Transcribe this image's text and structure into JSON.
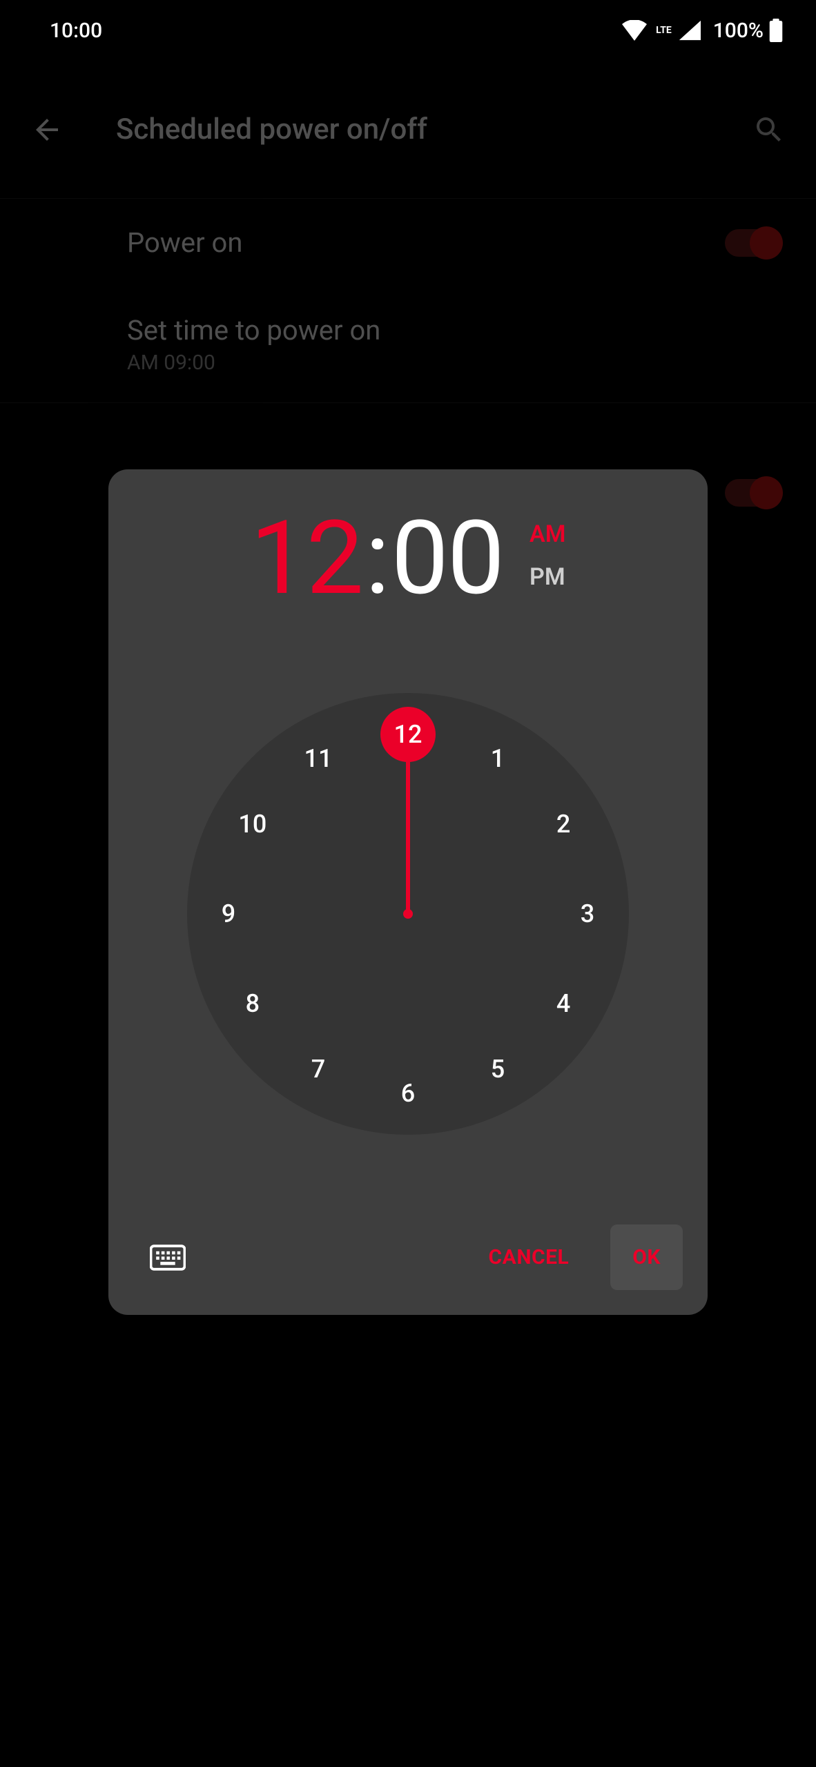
{
  "status": {
    "time": "10:00",
    "lte_label": "LTE",
    "battery_pct": "100%"
  },
  "page": {
    "title": "Scheduled power on/off",
    "rows": {
      "power_on": {
        "label": "Power on"
      },
      "set_time_on": {
        "label": "Set time to power on",
        "sub": "AM 09:00"
      }
    }
  },
  "dialog": {
    "hour": "12",
    "colon": ":",
    "minute": "00",
    "am_label": "AM",
    "pm_label": "PM",
    "selected_period": "AM",
    "selected_hour": 12,
    "cancel_label": "CANCEL",
    "ok_label": "OK",
    "clock_numbers": [
      "12",
      "1",
      "2",
      "3",
      "4",
      "5",
      "6",
      "7",
      "8",
      "9",
      "10",
      "11"
    ]
  },
  "colors": {
    "accent": "#eb0029",
    "dialog_bg": "#3e3e3e",
    "clock_bg": "#343434"
  }
}
